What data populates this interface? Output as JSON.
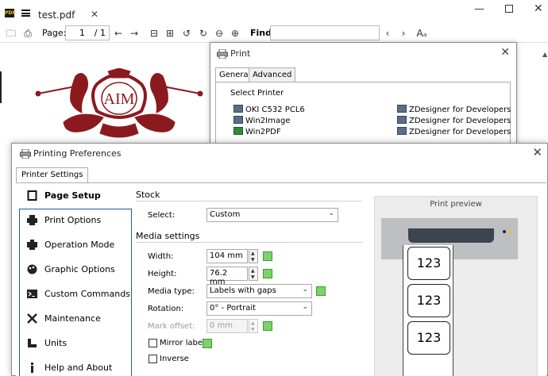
{
  "viewer": {
    "tab_title": "test.pdf",
    "tab_close": "✕",
    "page_label": "Page:",
    "page_current": "1",
    "page_total": "/ 1",
    "find_label": "Find:",
    "find_value": "",
    "find_case_glyph": "Aₐ"
  },
  "logo": {
    "text": "AIM",
    "color": "#8b1a1f"
  },
  "print_dialog": {
    "title": "Print",
    "tabs": [
      "General",
      "Advanced"
    ],
    "select_printer_label": "Select Printer",
    "printers_left": [
      "OKI C532 PCL6",
      "Win2Image",
      "Win2PDF"
    ],
    "printers_right": [
      "ZDesigner for Developers",
      "ZDesigner for Developers",
      "ZDesigner for Developers"
    ]
  },
  "prefs_dialog": {
    "title": "Printing Preferences",
    "tab": "Printer Settings",
    "nav": [
      {
        "label": "Page Setup",
        "icon": "page-setup-icon"
      },
      {
        "label": "Print Options",
        "icon": "printer-icon"
      },
      {
        "label": "Operation Mode",
        "icon": "operation-mode-icon"
      },
      {
        "label": "Graphic Options",
        "icon": "graphic-options-icon"
      },
      {
        "label": "Custom Commands",
        "icon": "terminal-icon"
      },
      {
        "label": "Maintenance",
        "icon": "tools-icon"
      },
      {
        "label": "Units",
        "icon": "ruler-icon"
      },
      {
        "label": "Help and About",
        "icon": "info-icon"
      }
    ],
    "stock": {
      "heading": "Stock",
      "select_label": "Select:",
      "select_value": "Custom"
    },
    "media": {
      "heading": "Media settings",
      "width_label": "Width:",
      "width_value": "104 mm",
      "height_label": "Height:",
      "height_value": "76.2 mm",
      "type_label": "Media type:",
      "type_value": "Labels with gaps",
      "rotation_label": "Rotation:",
      "rotation_value": "0° - Portrait",
      "offset_label": "Mark offset:",
      "offset_value": "0 mm",
      "mirror_label": "Mirror label",
      "inverse_label": "Inverse"
    },
    "preview": {
      "title": "Print preview",
      "labels": [
        "123",
        "123",
        "123"
      ]
    }
  }
}
